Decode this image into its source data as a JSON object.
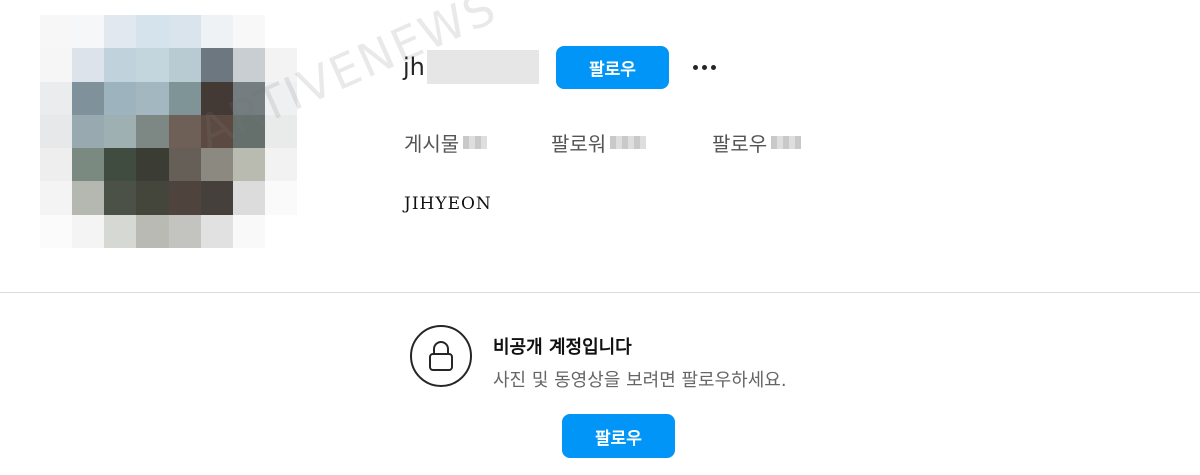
{
  "profile": {
    "avatar_pixels": [
      [
        "#f7f7f7",
        "#f5f7f8",
        "#e1e8ef",
        "#d5e3ec",
        "#d9e4ec",
        "#eef2f5",
        "#f8f8f8",
        "#ffffff"
      ],
      [
        "#f6f6f6",
        "#dce3ea",
        "#c0d2dc",
        "#c3d5dd",
        "#b8cad2",
        "#6c7780",
        "#c9ced3",
        "#f3f3f3"
      ],
      [
        "#eaecee",
        "#7f929c",
        "#9db3bd",
        "#a2b7c0",
        "#7f9497",
        "#433a36",
        "#747d80",
        "#eef0f1"
      ],
      [
        "#e6e8ea",
        "#98a9b0",
        "#9fb0b3",
        "#7d8884",
        "#6e5f57",
        "#5c4a42",
        "#65706c",
        "#e9ebeb"
      ],
      [
        "#eeeeee",
        "#7b8a80",
        "#404c40",
        "#3b3d34",
        "#655f58",
        "#8c8a80",
        "#b9bab0",
        "#f2f2f2"
      ],
      [
        "#f4f4f4",
        "#b4b8b0",
        "#4b5147",
        "#44463c",
        "#4e443d",
        "#45403c",
        "#dcdcdc",
        "#fafafa"
      ],
      [
        "#fbfbfb",
        "#f4f4f4",
        "#d6d8d4",
        "#b9bab4",
        "#c3c4c0",
        "#e1e1e1",
        "#f9f9f9",
        "#ffffff"
      ]
    ],
    "username_visible": "jh",
    "follow_label": "팔로우",
    "stats": {
      "posts_label": "게시물",
      "followers_label": "팔로워",
      "following_label": "팔로우"
    },
    "full_name": "JIHYEON"
  },
  "watermark": "ARTIVENEWS",
  "private_notice": {
    "title": "비공개 계정입니다",
    "subtitle": "사진 및 동영상을 보려면 팔로우하세요.",
    "follow_label": "팔로우",
    "icon": "lock-icon"
  },
  "colors": {
    "accent": "#0095f6",
    "text": "#262626",
    "divider": "#dbdbdb"
  }
}
